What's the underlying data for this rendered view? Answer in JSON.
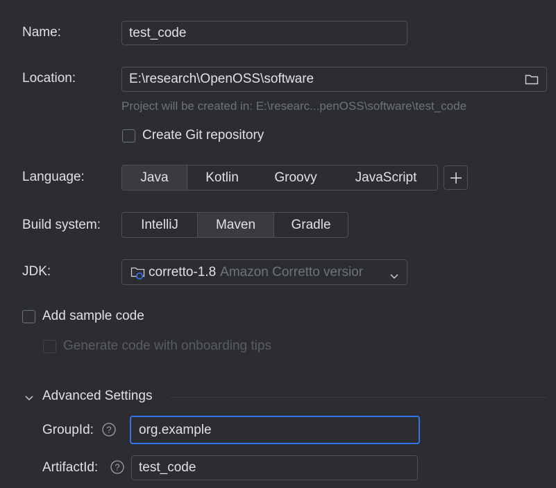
{
  "name": {
    "label": "Name:",
    "value": "test_code"
  },
  "location": {
    "label": "Location:",
    "value": "E:\\research\\OpenOSS\\software",
    "hint": "Project will be created in: E:\\researc...penOSS\\software\\test_code"
  },
  "git": {
    "label": "Create Git repository",
    "checked": false
  },
  "language": {
    "label": "Language:",
    "options": [
      "Java",
      "Kotlin",
      "Groovy",
      "JavaScript"
    ],
    "selected": "Java",
    "add_icon": "plus-icon"
  },
  "build_system": {
    "label": "Build system:",
    "options": [
      "IntelliJ",
      "Maven",
      "Gradle"
    ],
    "selected": "Maven"
  },
  "jdk": {
    "label": "JDK:",
    "name": "corretto-1.8",
    "detail": "Amazon Corretto versior",
    "icon": "jdk-folder-icon"
  },
  "sample_code": {
    "label": "Add sample code",
    "checked": false
  },
  "onboarding": {
    "label": "Generate code with onboarding tips",
    "checked": false,
    "disabled": true
  },
  "advanced": {
    "title": "Advanced Settings",
    "expanded": true,
    "group_id": {
      "label": "GroupId:",
      "value": "org.example"
    },
    "artifact_id": {
      "label": "ArtifactId:",
      "value": "test_code"
    }
  },
  "colors": {
    "background": "#2b2d30",
    "accent": "#3574f0",
    "border": "#4e5157",
    "hint": "#6f737a"
  }
}
